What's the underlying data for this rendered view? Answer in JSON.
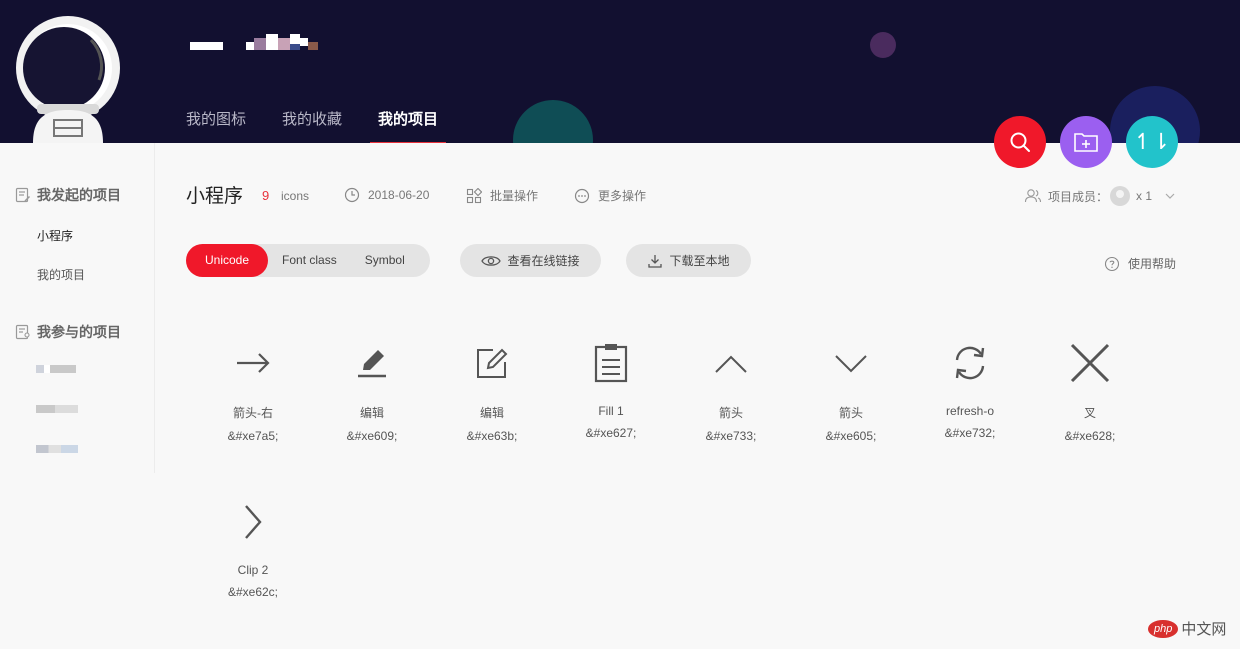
{
  "header": {
    "nav": [
      "我的图标",
      "我的收藏",
      "我的项目"
    ],
    "active_nav": "我的项目"
  },
  "fabs": {
    "search": "search-icon",
    "add_folder": "folder-add-icon",
    "sort": "↿⇂"
  },
  "sidebar": {
    "initiated_heading": "我发起的项目",
    "initiated_items": [
      "小程序",
      "我的项目"
    ],
    "joined_heading": "我参与的项目"
  },
  "project": {
    "title": "小程序",
    "icon_count": "9",
    "icon_count_label": "icons",
    "date": "2018-06-20",
    "batch": "批量操作",
    "more": "更多操作",
    "members_label": "项目成员：",
    "members_count": "x 1"
  },
  "toolbar": {
    "modes": [
      "Unicode",
      "Font class",
      "Symbol"
    ],
    "active_mode": "Unicode",
    "view_link": "查看在线链接",
    "download": "下载至本地",
    "help": "使用帮助"
  },
  "icons": [
    {
      "name": "箭头-右",
      "code": "&#xe7a5;",
      "icon": "arrow-right-icon"
    },
    {
      "name": "编辑",
      "code": "&#xe609;",
      "icon": "pencil-icon"
    },
    {
      "name": "编辑",
      "code": "&#xe63b;",
      "icon": "edit-box-icon"
    },
    {
      "name": "Fill 1",
      "code": "&#xe627;",
      "icon": "clipboard-icon"
    },
    {
      "name": "箭头",
      "code": "&#xe733;",
      "icon": "chevron-up-icon"
    },
    {
      "name": "箭头",
      "code": "&#xe605;",
      "icon": "chevron-down-icon"
    },
    {
      "name": "refresh-o",
      "code": "&#xe732;",
      "icon": "refresh-icon"
    },
    {
      "name": "叉",
      "code": "&#xe628;",
      "icon": "close-icon"
    },
    {
      "name": "Clip 2",
      "code": "&#xe62c;",
      "icon": "chevron-right-icon"
    }
  ],
  "watermark": {
    "badge": "php",
    "text": "中文网"
  },
  "colors": {
    "header_bg": "#121030",
    "accent_red": "#f0182a",
    "purple": "#9b5ff0",
    "teal": "#22c3cb"
  }
}
